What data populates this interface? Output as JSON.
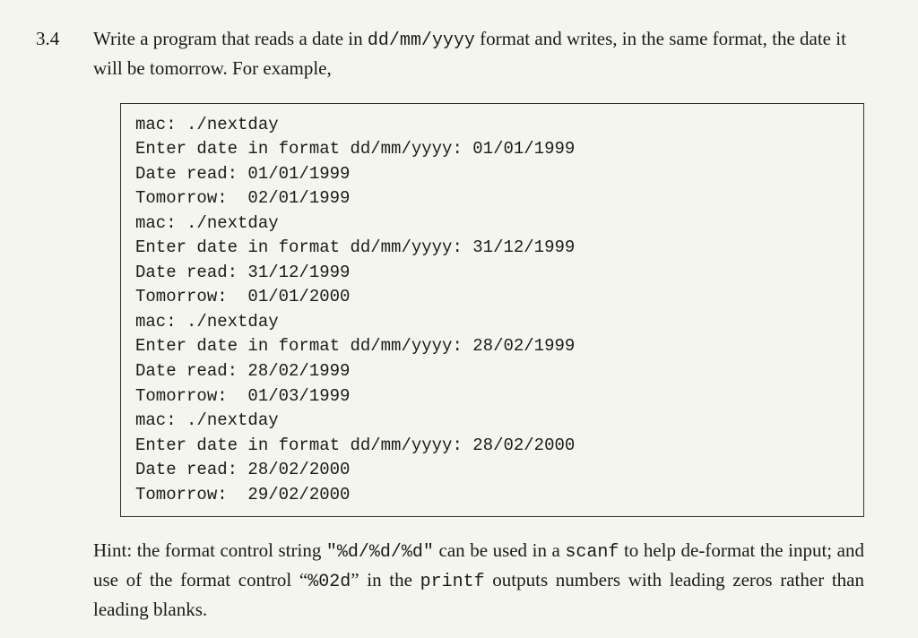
{
  "exercise": {
    "number": "3.4",
    "problem_part1": "Write a program that reads a date in ",
    "problem_code1": "dd/mm/yyyy",
    "problem_part2": " format and writes, in the same format, the date it will be tomorrow. For example,",
    "code_lines": [
      "mac: ./nextday",
      "Enter date in format dd/mm/yyyy: 01/01/1999",
      "Date read: 01/01/1999",
      "Tomorrow:  02/01/1999",
      "mac: ./nextday",
      "Enter date in format dd/mm/yyyy: 31/12/1999",
      "Date read: 31/12/1999",
      "Tomorrow:  01/01/2000",
      "mac: ./nextday",
      "Enter date in format dd/mm/yyyy: 28/02/1999",
      "Date read: 28/02/1999",
      "Tomorrow:  01/03/1999",
      "mac: ./nextday",
      "Enter date in format dd/mm/yyyy: 28/02/2000",
      "Date read: 28/02/2000",
      "Tomorrow:  29/02/2000"
    ],
    "hint_part1": "Hint: the format control string ",
    "hint_code1": "\"%d/%d/%d\"",
    "hint_part2": " can be used in a ",
    "hint_code2": "scanf",
    "hint_part3": " to help de-format the input; and use of the format control “",
    "hint_code3": "%02d",
    "hint_part4": "” in the ",
    "hint_code4": "printf",
    "hint_part5": " outputs numbers with leading zeros rather than leading blanks."
  }
}
